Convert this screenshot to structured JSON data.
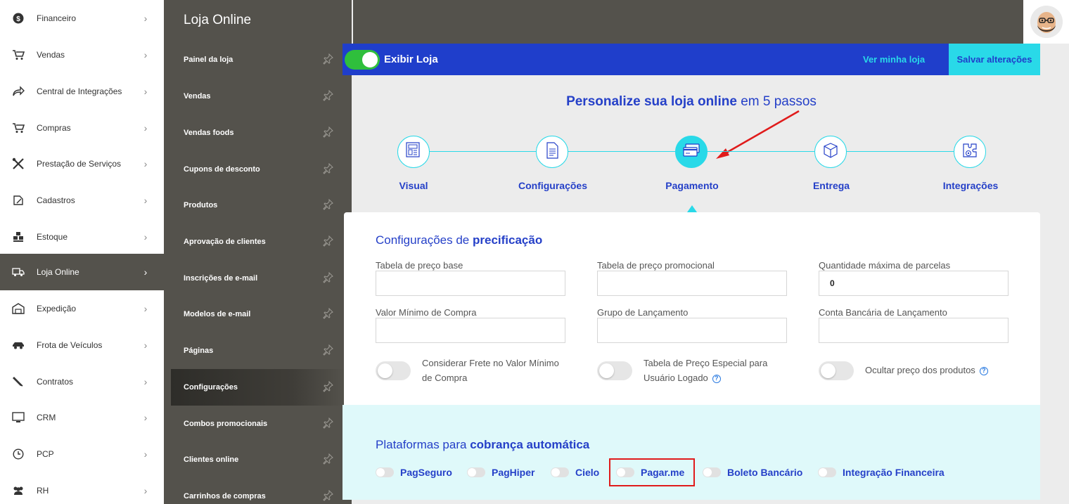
{
  "main_sidebar": {
    "items": [
      {
        "label": "Financeiro",
        "icon": "dollar-coin-icon"
      },
      {
        "label": "Vendas",
        "icon": "cart-icon"
      },
      {
        "label": "Central de Integrações",
        "icon": "share-arrow-icon"
      },
      {
        "label": "Compras",
        "icon": "cart-icon"
      },
      {
        "label": "Prestação de Serviços",
        "icon": "tools-icon"
      },
      {
        "label": "Cadastros",
        "icon": "edit-icon"
      },
      {
        "label": "Estoque",
        "icon": "boxes-icon"
      },
      {
        "label": "Loja Online",
        "icon": "truck-icon",
        "active": true
      },
      {
        "label": "Expedição",
        "icon": "warehouse-icon"
      },
      {
        "label": "Frota de Veículos",
        "icon": "car-icon"
      },
      {
        "label": "Contratos",
        "icon": "pen-icon"
      },
      {
        "label": "CRM",
        "icon": "monitor-icon"
      },
      {
        "label": "PCP",
        "icon": "clock-icon"
      },
      {
        "label": "RH",
        "icon": "people-icon"
      }
    ]
  },
  "sub_sidebar": {
    "title": "Loja Online",
    "items": [
      {
        "label": "Painel da loja"
      },
      {
        "label": "Vendas"
      },
      {
        "label": "Vendas foods"
      },
      {
        "label": "Cupons de desconto"
      },
      {
        "label": "Produtos"
      },
      {
        "label": "Aprovação de clientes"
      },
      {
        "label": "Inscrições de e-mail"
      },
      {
        "label": "Modelos de e-mail"
      },
      {
        "label": "Páginas"
      },
      {
        "label": "Configurações",
        "active": true
      },
      {
        "label": "Combos promocionais"
      },
      {
        "label": "Clientes online"
      },
      {
        "label": "Carrinhos de compras"
      }
    ]
  },
  "toolbar": {
    "toggle_label": "Exibir Loja",
    "toggle_on": true,
    "view_store": "Ver minha loja",
    "save": "Salvar alterações"
  },
  "steps": {
    "title_bold": "Personalize sua loja online",
    "title_rest": " em 5 passos",
    "items": [
      {
        "label": "Visual",
        "icon": "visual-layout-icon"
      },
      {
        "label": "Configurações",
        "icon": "document-icon"
      },
      {
        "label": "Pagamento",
        "icon": "credit-card-icon",
        "active": true
      },
      {
        "label": "Entrega",
        "icon": "package-box-icon"
      },
      {
        "label": "Integrações",
        "icon": "puzzle-gear-icon"
      }
    ]
  },
  "pricing": {
    "title_normal": "Configurações de ",
    "title_bold": "precificação",
    "fields": {
      "tabela_base": {
        "label": "Tabela de preço base",
        "value": ""
      },
      "tabela_promo": {
        "label": "Tabela de preço promocional",
        "value": ""
      },
      "parcelas": {
        "label": "Quantidade máxima de parcelas",
        "value": "0"
      },
      "valor_minimo": {
        "label": "Valor Mínimo de Compra",
        "value": ""
      },
      "grupo": {
        "label": "Grupo de Lançamento",
        "value": ""
      },
      "conta": {
        "label": "Conta Bancária de Lançamento",
        "value": ""
      }
    },
    "switches": {
      "frete": {
        "line1": "Considerar Frete no Valor Mínimo",
        "line2": "de Compra"
      },
      "especial": {
        "line1": "Tabela de Preço Especial para",
        "line2": "Usuário Logado"
      },
      "ocultar": {
        "line1": "Ocultar preço dos produtos"
      }
    }
  },
  "billing": {
    "title_normal": "Plataformas para ",
    "title_bold": "cobrança automática",
    "platforms": [
      "PagSeguro",
      "PagHiper",
      "Cielo",
      "Pagar.me",
      "Boleto Bancário",
      "Integração Financeira"
    ]
  },
  "colors": {
    "brand_blue": "#1f3ecb",
    "accent_cyan": "#29d9e8",
    "sidebar_dark": "#54524c",
    "toggle_green": "#2fbf3c",
    "highlight_red": "#e01b1b"
  }
}
